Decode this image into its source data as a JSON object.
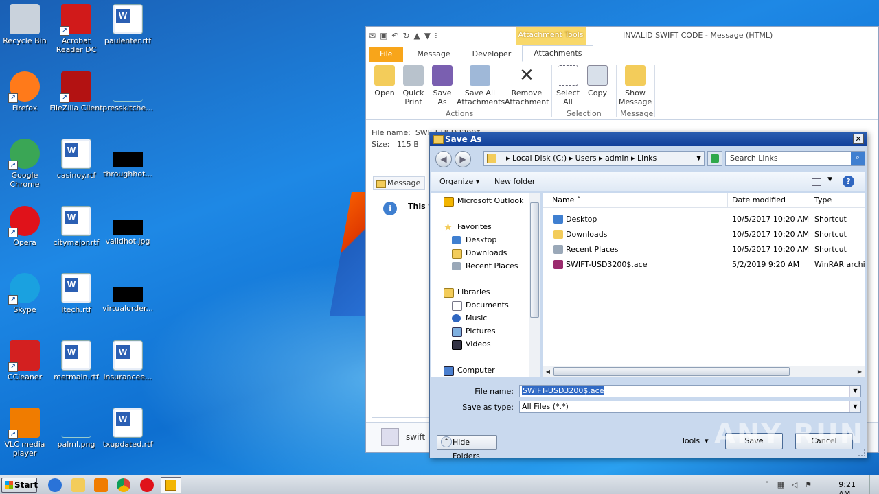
{
  "desktop": {
    "icons": [
      {
        "label": "Recycle Bin",
        "icon": "recycle-bin-icon",
        "color": "#c9d2dc"
      },
      {
        "label": "Acrobat Reader DC",
        "icon": "acrobat-icon",
        "color": "#d11a1a"
      },
      {
        "label": "paulenter.rtf",
        "icon": "word-doc-icon"
      },
      {
        "label": "Firefox",
        "icon": "firefox-icon",
        "color": "#ff7a1a"
      },
      {
        "label": "FileZilla Client",
        "icon": "filezilla-icon",
        "color": "#b31212"
      },
      {
        "label": "presskitche...",
        "icon": "blank-file-icon"
      },
      {
        "label": "Google Chrome",
        "icon": "chrome-icon",
        "color": "#3aa655"
      },
      {
        "label": "casinoy.rtf",
        "icon": "word-doc-icon"
      },
      {
        "label": "throughhot...",
        "icon": "image-file-icon"
      },
      {
        "label": "Opera",
        "icon": "opera-icon",
        "color": "#e0121a"
      },
      {
        "label": "citymajor.rtf",
        "icon": "word-doc-icon"
      },
      {
        "label": "validhot.jpg",
        "icon": "image-file-icon"
      },
      {
        "label": "Skype",
        "icon": "skype-icon",
        "color": "#1aa1e0"
      },
      {
        "label": "ltech.rtf",
        "icon": "word-doc-icon"
      },
      {
        "label": "virtualorder...",
        "icon": "image-file-icon"
      },
      {
        "label": "CCleaner",
        "icon": "ccleaner-icon",
        "color": "#d32020"
      },
      {
        "label": "metmain.rtf",
        "icon": "word-doc-icon"
      },
      {
        "label": "insurancee...",
        "icon": "word-doc-icon"
      },
      {
        "label": "VLC media player",
        "icon": "vlc-icon",
        "color": "#f07c00"
      },
      {
        "label": "palml.png",
        "icon": "blank-file-icon"
      },
      {
        "label": "txupdated.rtf",
        "icon": "word-doc-icon"
      }
    ]
  },
  "outlook": {
    "context_tab": "Attachment Tools",
    "caption": "INVALID SWIFT CODE  -  Message (HTML)",
    "tabs": [
      "File",
      "Message",
      "Developer",
      "Attachments"
    ],
    "ribbon": {
      "open": "Open",
      "quick_print": "Quick Print",
      "save_as": "Save As",
      "save_all": "Save All Attachments",
      "remove": "Remove Attachment",
      "select_all": "Select All",
      "copy": "Copy",
      "show_message": "Show Message",
      "group_actions": "Actions",
      "group_selection": "Selection",
      "group_message": "Message"
    },
    "file_name_label": "File name:",
    "file_name_value": "SWIFT-USD3200$",
    "size_label": "Size:",
    "size_value": "115 B",
    "message_tab": "Message",
    "body_text": "This fi",
    "sender": "swift"
  },
  "save_dialog": {
    "title": "Save As",
    "close": "✕",
    "breadcrumb": [
      "Local Disk (C:)",
      "Users",
      "admin",
      "Links"
    ],
    "search_placeholder": "Search Links",
    "organize": "Organize",
    "new_folder": "New folder",
    "tree": [
      {
        "label": "Microsoft Outlook",
        "kind": "outlook"
      },
      {
        "label": "Favorites",
        "kind": "star"
      },
      {
        "label": "Desktop",
        "kind": "blue"
      },
      {
        "label": "Downloads",
        "kind": "fold"
      },
      {
        "label": "Recent Places",
        "kind": "grey"
      },
      {
        "label": "Libraries",
        "kind": "fold"
      },
      {
        "label": "Documents",
        "kind": "doc"
      },
      {
        "label": "Music",
        "kind": "music"
      },
      {
        "label": "Pictures",
        "kind": "pic"
      },
      {
        "label": "Videos",
        "kind": "vid"
      },
      {
        "label": "Computer",
        "kind": "comp"
      }
    ],
    "columns": {
      "name": "Name",
      "date": "Date modified",
      "type": "Type"
    },
    "files": [
      {
        "name": "Desktop",
        "date": "10/5/2017 10:20 AM",
        "type": "Shortcut",
        "icon_color": "#3f7fd0"
      },
      {
        "name": "Downloads",
        "date": "10/5/2017 10:20 AM",
        "type": "Shortcut",
        "icon_color": "#f3cc5a"
      },
      {
        "name": "Recent Places",
        "date": "10/5/2017 10:20 AM",
        "type": "Shortcut",
        "icon_color": "#9aa8b8"
      },
      {
        "name": "SWIFT-USD3200$.ace",
        "date": "5/2/2019 9:20 AM",
        "type": "WinRAR archive",
        "icon_color": "#9b2b6e"
      }
    ],
    "file_name_label": "File name:",
    "file_name_value": "SWIFT-USD3200$.ace",
    "save_type_label": "Save as type:",
    "save_type_value": "All Files (*.*)",
    "hide_folders": "Hide Folders",
    "tools": "Tools",
    "save": "Save",
    "cancel": "Cancel"
  },
  "watermark": "ANY RUN",
  "taskbar": {
    "start": "Start",
    "time": "9:21 AM"
  }
}
